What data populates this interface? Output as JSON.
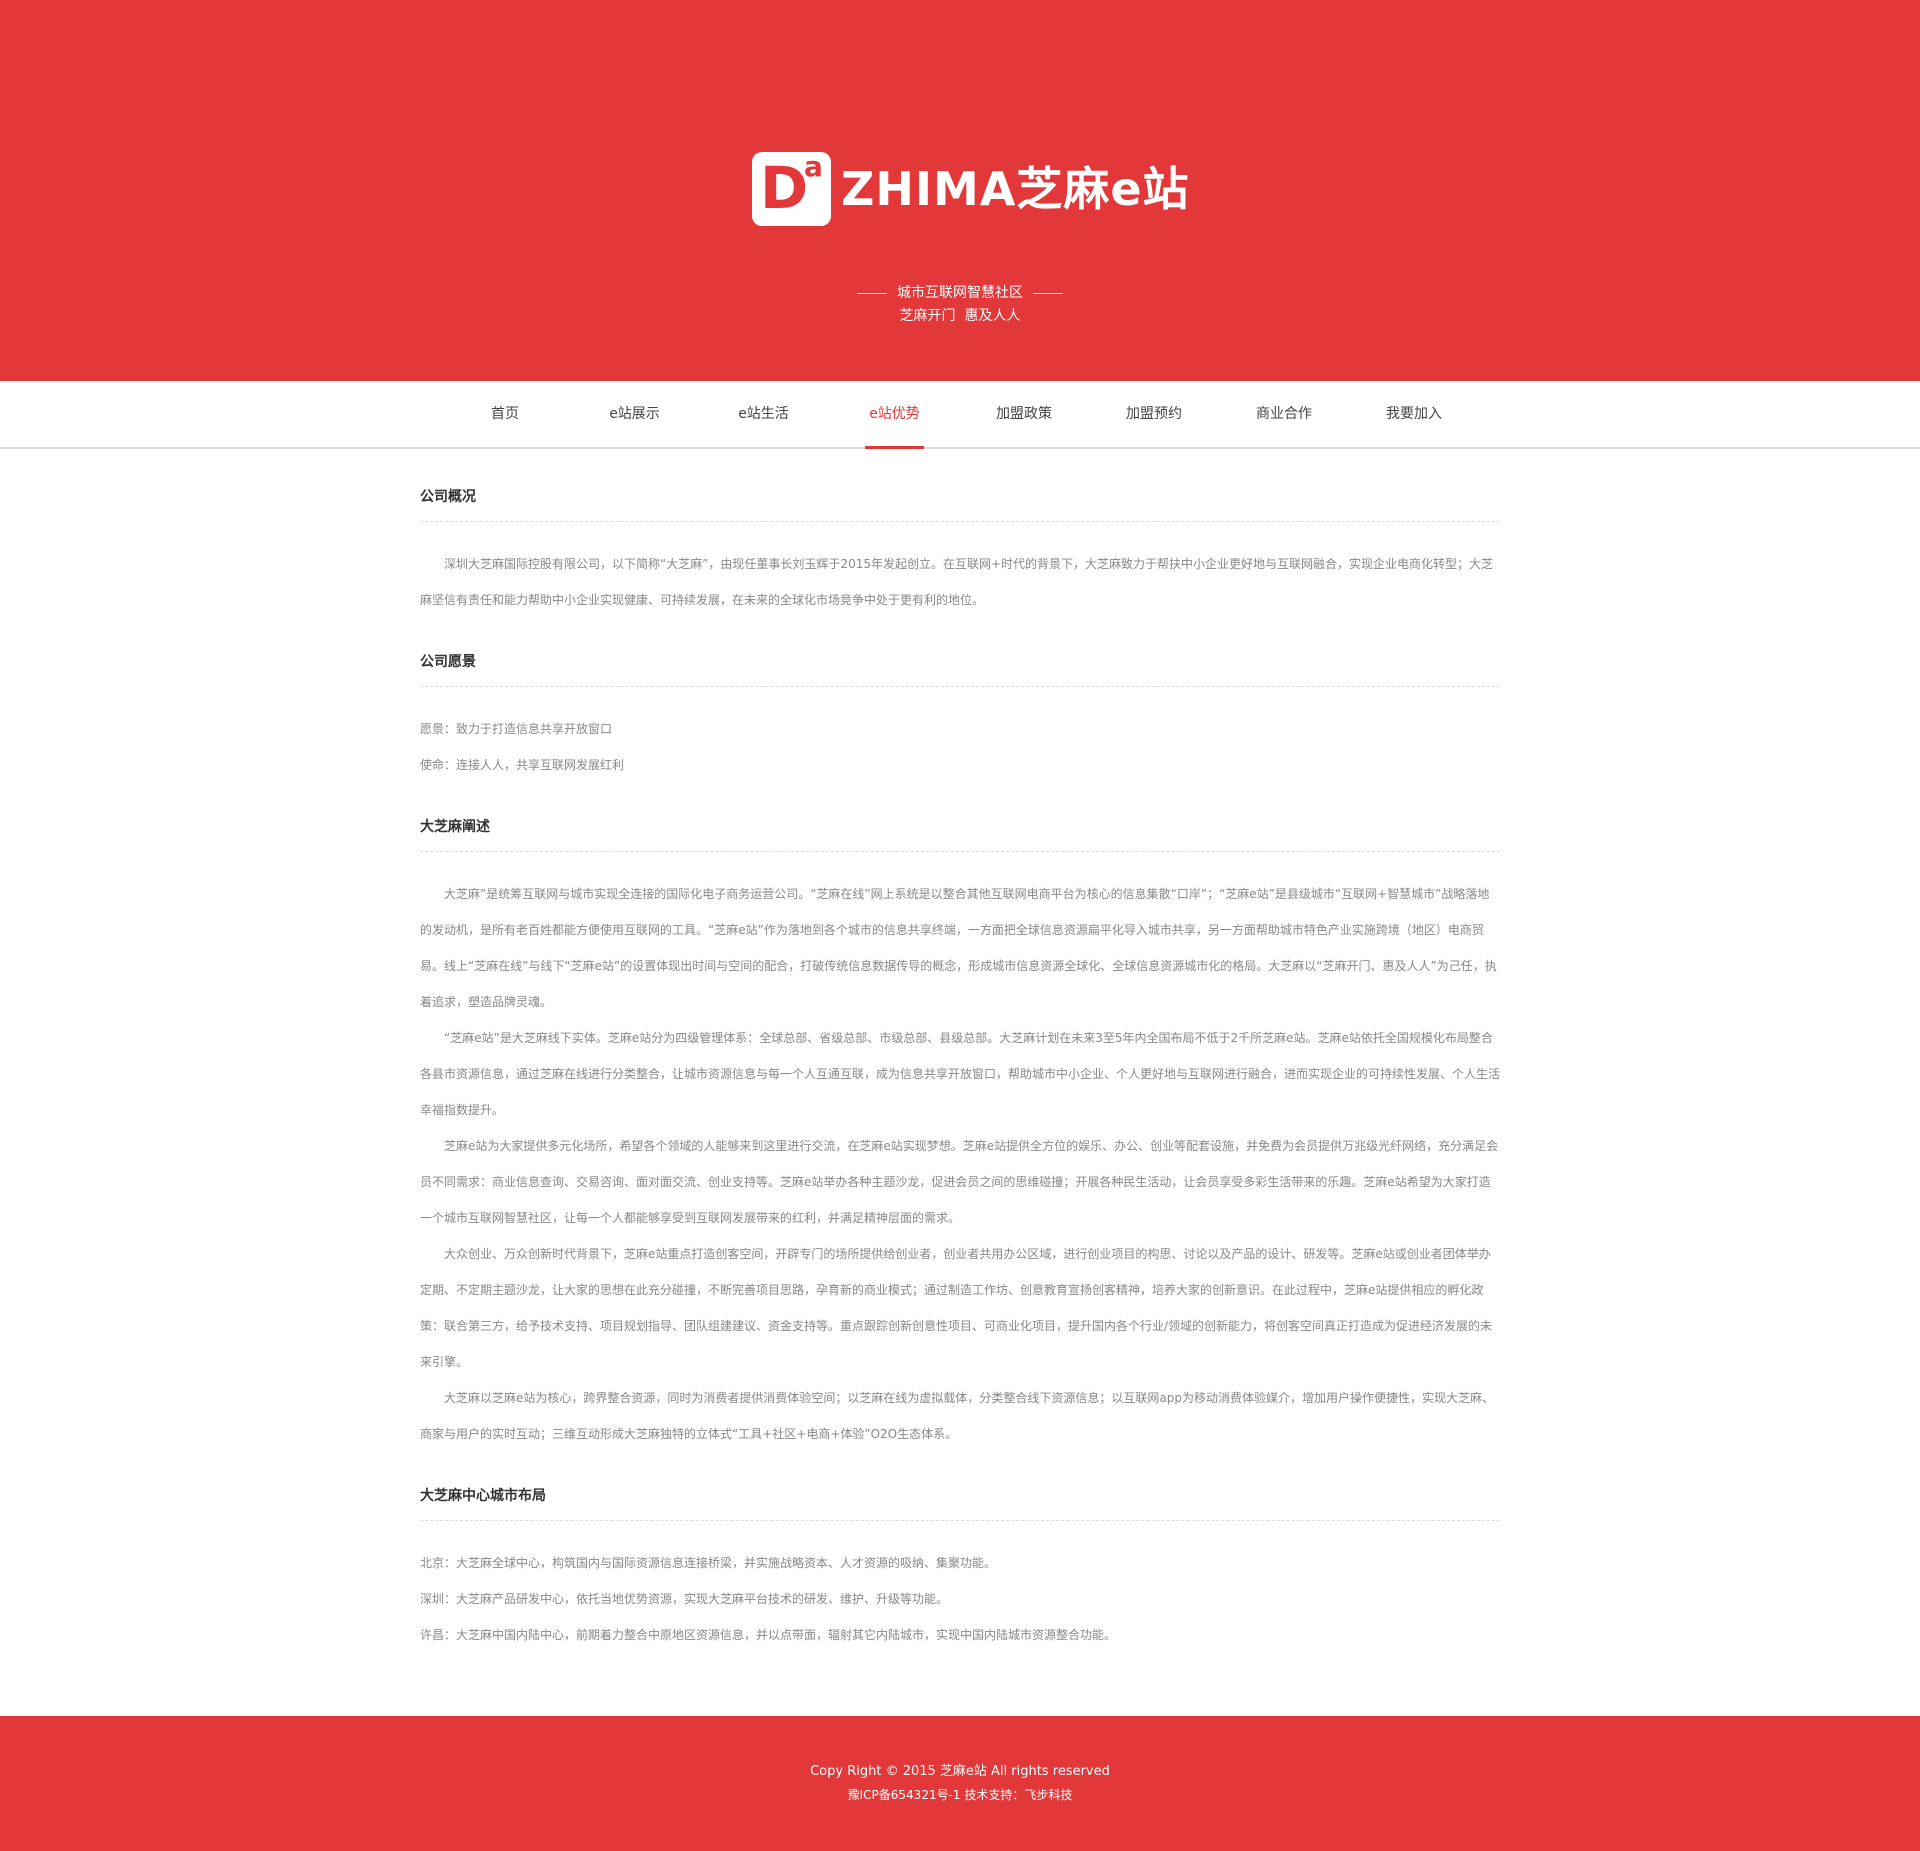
{
  "header": {
    "logo_letter": "D",
    "logo_sup": "a",
    "logo_text": "ZHIMA芝麻e站",
    "slogan_line1": "城市互联网智慧社区",
    "slogan_line2": "芝麻开门  惠及人人",
    "background_color": "#e2383a"
  },
  "nav": {
    "items": [
      {
        "label": "首页"
      },
      {
        "label": "e站展示"
      },
      {
        "label": "e站生活"
      },
      {
        "label": "e站优势"
      },
      {
        "label": "加盟政策"
      },
      {
        "label": "加盟预约"
      },
      {
        "label": "商业合作"
      },
      {
        "label": "我要加入"
      }
    ],
    "active_label": "e站优势"
  },
  "sections": {
    "overview": {
      "title": "公司概况",
      "paragraphs": [
        "深圳大芝麻国际控股有限公司，以下简称“大芝麻”，由现任董事长刘玉辉于2015年发起创立。在互联网+时代的背景下，大芝麻致力于帮扶中小企业更好地与互联网融合，实现企业电商化转型；大芝麻坚信有责任和能力帮助中小企业实现健康、可持续发展，在未来的全球化市场竞争中处于更有利的地位。"
      ]
    },
    "vision": {
      "title": "公司愿景",
      "lines": [
        "愿景：致力于打造信息共享开放窗口",
        "使命：连接人人，共享互联网发展红利"
      ]
    },
    "explain": {
      "title": "大芝麻阐述",
      "paragraphs": [
        "大芝麻”是统筹互联网与城市实现全连接的国际化电子商务运营公司。“芝麻在线”网上系统是以整合其他互联网电商平台为核心的信息集散“口岸”；“芝麻e站”是县级城市“互联网+智慧城市”战略落地的发动机，是所有老百姓都能方便使用互联网的工具。“芝麻e站”作为落地到各个城市的信息共享终端，一方面把全球信息资源扁平化导入城市共享，另一方面帮助城市特色产业实施跨境（地区）电商贸易。线上“芝麻在线”与线下“芝麻e站”的设置体现出时间与空间的配合，打破传统信息数据传导的概念，形成城市信息资源全球化、全球信息资源城市化的格局。大芝麻以“芝麻开门、惠及人人”为己任，执着追求，塑造品牌灵魂。",
        "“芝麻e站”是大芝麻线下实体。芝麻e站分为四级管理体系：全球总部、省级总部、市级总部、县级总部。大芝麻计划在未来3至5年内全国布局不低于2千所芝麻e站。芝麻e站依托全国规模化布局整合各县市资源信息，通过芝麻在线进行分类整合，让城市资源信息与每一个人互通互联，成为信息共享开放窗口，帮助城市中小企业、个人更好地与互联网进行融合，进而实现企业的可持续性发展、个人生活幸福指数提升。",
        "芝麻e站为大家提供多元化场所，希望各个领域的人能够来到这里进行交流，在芝麻e站实现梦想。芝麻e站提供全方位的娱乐、办公、创业等配套设施，并免费为会员提供万兆级光纤网络，充分满足会员不同需求：商业信息查询、交易咨询、面对面交流、创业支持等。芝麻e站举办各种主题沙龙，促进会员之间的思维碰撞；开展各种民生活动，让会员享受多彩生活带来的乐趣。芝麻e站希望为大家打造一个城市互联网智慧社区，让每一个人都能够享受到互联网发展带来的红利，并满足精神层面的需求。",
        "大众创业、万众创新时代背景下，芝麻e站重点打造创客空间，开辟专门的场所提供给创业者，创业者共用办公区域，进行创业项目的构思、讨论以及产品的设计、研发等。芝麻e站或创业者团体举办定期、不定期主题沙龙，让大家的思想在此充分碰撞，不断完善项目思路，孕育新的商业模式；通过制造工作坊、创意教育宣扬创客精神，培养大家的创新意识。在此过程中，芝麻e站提供相应的孵化政策：联合第三方，给予技术支持、项目规划指导、团队组建建议、资金支持等。重点跟踪创新创意性项目、可商业化项目，提升国内各个行业/领域的创新能力，将创客空间真正打造成为促进经济发展的未来引擎。",
        "大芝麻以芝麻e站为核心，跨界整合资源，同时为消费者提供消费体验空间；以芝麻在线为虚拟载体，分类整合线下资源信息；以互联网app为移动消费体验媒介，增加用户操作便捷性，实现大芝麻、商家与用户的实时互动；三维互动形成大芝麻独特的立体式“工具+社区+电商+体验”O2O生态体系。"
      ]
    },
    "cities": {
      "title": "大芝麻中心城市布局",
      "lines": [
        "北京：大芝麻全球中心，构筑国内与国际资源信息连接桥梁，并实施战略资本、人才资源的吸纳、集聚功能。",
        "深圳：大芝麻产品研发中心，依托当地优势资源，实现大芝麻平台技术的研发、维护、升级等功能。",
        "许昌：大芝麻中国内陆中心，前期着力整合中原地区资源信息，并以点带面，辐射其它内陆城市，实现中国内陆城市资源整合功能。"
      ]
    }
  },
  "footer": {
    "copyright": "Copy Right © 2015 芝麻e站 All rights reserved",
    "icp": "豫ICP备654321号-1 技术支持：飞步科技"
  }
}
